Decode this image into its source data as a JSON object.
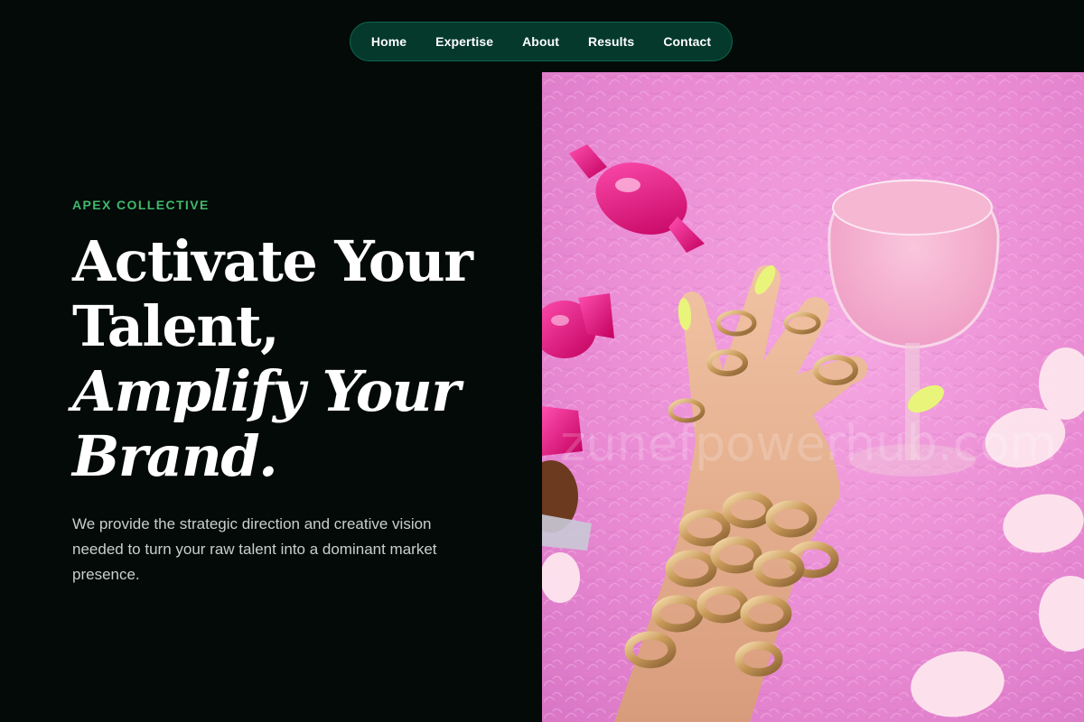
{
  "nav": {
    "items": [
      {
        "label": "Home"
      },
      {
        "label": "Expertise"
      },
      {
        "label": "About"
      },
      {
        "label": "Results"
      },
      {
        "label": "Contact"
      }
    ]
  },
  "hero": {
    "eyebrow": "APEX COLLECTIVE",
    "headline": {
      "line1": "Activate Your",
      "line2": "Talent,",
      "line3": "Amplify Your",
      "line4": "Brand."
    },
    "lede": "We provide the strategic direction and creative vision needed to turn your raw talent into a dominant market presence.",
    "image": {
      "watermark": "zunefpowerhub.com"
    }
  },
  "colors": {
    "background": "#030a08",
    "nav_bg": "#04392c",
    "accent_green": "#41b86a",
    "image_pink": "#ec8fd6"
  }
}
